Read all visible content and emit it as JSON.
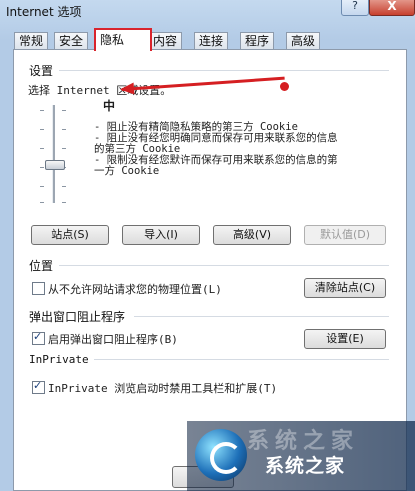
{
  "window": {
    "title": "Internet 选项",
    "help_label": "?",
    "close_label": "X"
  },
  "tabs": [
    {
      "label": "常规"
    },
    {
      "label": "安全"
    },
    {
      "label": "隐私"
    },
    {
      "label": "内容"
    },
    {
      "label": "连接"
    },
    {
      "label": "程序"
    },
    {
      "label": "高级"
    }
  ],
  "settings": {
    "group_title": "设置",
    "zone_text": "选择 Internet 区域设置。",
    "level": "中",
    "description": "- 阻止没有精简隐私策略的第三方 Cookie\n- 阻止没有经您明确同意而保存可用来联系您的信息\n的第三方 Cookie\n- 限制没有经您默许而保存可用来联系您的信息的第\n一方 Cookie",
    "buttons": {
      "sites": "站点(S)",
      "import": "导入(I)",
      "advanced": "高级(V)",
      "default": "默认值(D)"
    }
  },
  "location": {
    "group_title": "位置",
    "checkbox_label": "从不允许网站请求您的物理位置(L)",
    "checkbox_checked": false,
    "clear_button": "清除站点(C)"
  },
  "popup": {
    "group_title": "弹出窗口阻止程序",
    "checkbox_label": "启用弹出窗口阻止程序(B)",
    "checkbox_checked": true,
    "settings_button": "设置(E)"
  },
  "inprivate": {
    "group_title": "InPrivate",
    "checkbox_label": "InPrivate 浏览启动时禁用工具栏和扩展(T)",
    "checkbox_checked": true
  },
  "watermark": {
    "text": "系统之家",
    "faded_text": "系统之家"
  },
  "colors": {
    "highlight": "#d9242c",
    "arrow": "#d51f22"
  }
}
